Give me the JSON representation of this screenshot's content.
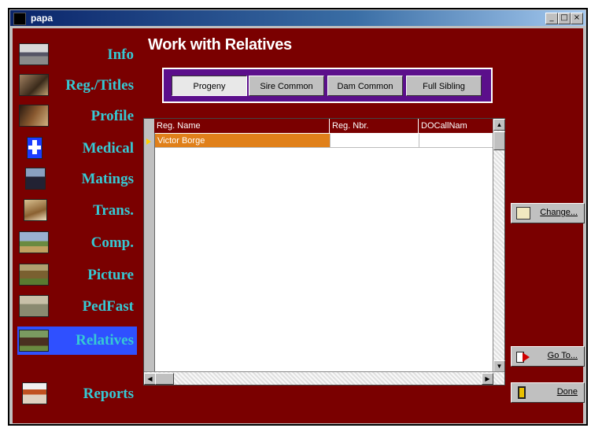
{
  "window": {
    "title": "papa",
    "controls": [
      "_",
      "□",
      "×"
    ]
  },
  "nav": {
    "items": [
      {
        "label": "Info",
        "icon": "stable-icon"
      },
      {
        "label": "Reg./Titles",
        "icon": "horse-icon"
      },
      {
        "label": "Profile",
        "icon": "horse-head-icon"
      },
      {
        "label": "Medical",
        "icon": "medical-cross-icon"
      },
      {
        "label": "Matings",
        "icon": "horses-icon"
      },
      {
        "label": "Trans.",
        "icon": "horse-head-icon"
      },
      {
        "label": "Comp.",
        "icon": "jumping-icon"
      },
      {
        "label": "Picture",
        "icon": "horse-field-icon"
      },
      {
        "label": "PedFast",
        "icon": "horses-icon"
      },
      {
        "label": "Relatives",
        "icon": "horse-group-icon",
        "active": true
      },
      {
        "label": "Reports",
        "icon": "reports-icon"
      }
    ]
  },
  "main": {
    "title": "Work with Relatives",
    "tabs": [
      {
        "label": "Progeny",
        "selected": true
      },
      {
        "label": "Sire Common"
      },
      {
        "label": "Dam Common"
      },
      {
        "label": "Full Sibling"
      }
    ],
    "grid": {
      "columns": [
        "Reg. Name",
        "Reg. Nbr.",
        "DOCallNam"
      ],
      "rows": [
        [
          "Victor Borge",
          "",
          ""
        ]
      ]
    }
  },
  "actions": {
    "change": "Change...",
    "goto": "Go To...",
    "done": "Done"
  },
  "colors": {
    "background": "#7a0000",
    "nav_text": "#36c9d4",
    "tab_frame": "#5b0f8b",
    "selected_row": "#e0801a",
    "active_nav": "#2f50ff"
  }
}
